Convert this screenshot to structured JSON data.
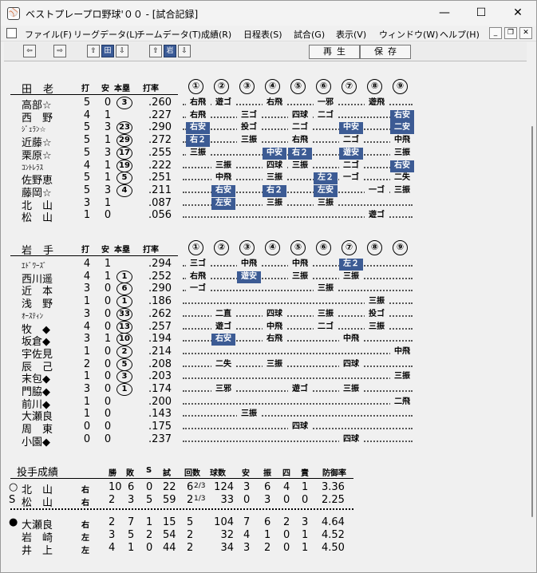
{
  "window": {
    "title": "ベストプレープロ野球'００ - [試合記録]",
    "minimize": "—",
    "maximize": "☐",
    "close": "✕"
  },
  "menu": [
    "ファイル(F)",
    "リーグデータ(L)",
    "チームデータ(T)",
    "成績(R)",
    "日程表(S)",
    "試合(G)",
    "表示(V)",
    "ウィンドウ(W)",
    "ヘルプ(H)"
  ],
  "toolbar": {
    "play_label": "再生",
    "save_label": "保存",
    "left_arrow": "⇦",
    "right_arrow": "⇨",
    "up_arrow_1": "⇧",
    "tag_1": "田",
    "down_arrow_1": "⇩",
    "up_arrow_2": "⇧",
    "tag_2": "岩",
    "down_arrow_2": "⇩"
  },
  "headers": {
    "ab": "打",
    "hits": "安",
    "hr": "本塁",
    "avg": "打率",
    "innings": [
      "①",
      "②",
      "③",
      "④",
      "⑤",
      "⑥",
      "⑦",
      "⑧",
      "⑨"
    ]
  },
  "teams": [
    {
      "name": "田老",
      "batters": [
        {
          "name": "高部☆",
          "ab": "5",
          "h": "0",
          "hr": "3",
          "avg": ".260",
          "res": [
            "右飛",
            "遊ゴ",
            "",
            "右飛",
            "",
            "一邪",
            "",
            "遊飛",
            ""
          ]
        },
        {
          "name": "西　野",
          "ab": "4",
          "h": "1",
          "hr": "",
          "avg": ".227",
          "res": [
            "右飛",
            "",
            "三ゴ",
            "",
            "四球",
            "二ゴ",
            "",
            "",
            "右安"
          ]
        },
        {
          "name": "ｼﾞｪﾗﾝ☆",
          "ab": "5",
          "h": "3",
          "hr": "23",
          "avg": ".290",
          "res": [
            "右安",
            "",
            "投ゴ",
            "",
            "二ゴ",
            "",
            "中安",
            "",
            "二安"
          ]
        },
        {
          "name": "近藤☆",
          "ab": "5",
          "h": "1",
          "hr": "29",
          "avg": ".272",
          "res": [
            "右２",
            "",
            "三振",
            "",
            "右飛",
            "",
            "二ゴ",
            "",
            "中飛"
          ]
        },
        {
          "name": "栗原☆",
          "ab": "5",
          "h": "3",
          "hr": "17",
          "avg": ".255",
          "res": [
            "三振",
            "",
            "",
            "中安",
            "右２",
            "",
            "遊安",
            "",
            "三振"
          ]
        },
        {
          "name": "ｺﾝﾄﾚﾗｽ",
          "ab": "4",
          "h": "1",
          "hr": "19",
          "avg": ".222",
          "res": [
            "",
            "三振",
            "",
            "四球",
            "三振",
            "",
            "二ゴ",
            "",
            "右安"
          ]
        },
        {
          "name": "佐野恵",
          "ab": "5",
          "h": "1",
          "hr": "5",
          "avg": ".251",
          "res": [
            "",
            "中飛",
            "",
            "三振",
            "",
            "左２",
            "一ゴ",
            "",
            "二失"
          ]
        },
        {
          "name": "藤岡☆",
          "ab": "5",
          "h": "3",
          "hr": "4",
          "avg": ".211",
          "res": [
            "",
            "右安",
            "",
            "右２",
            "",
            "左安",
            "",
            "一ゴ",
            "三振"
          ]
        },
        {
          "name": "北　山",
          "ab": "3",
          "h": "1",
          "hr": "",
          "avg": ".087",
          "res": [
            "",
            "左安",
            "",
            "三振",
            "",
            "三振",
            "",
            "",
            ""
          ]
        },
        {
          "name": "松　山",
          "ab": "1",
          "h": "0",
          "hr": "",
          "avg": ".056",
          "res": [
            "",
            "",
            "",
            "",
            "",
            "",
            "",
            "遊ゴ",
            ""
          ]
        }
      ]
    },
    {
      "name": "岩手",
      "batters": [
        {
          "name": "ｴﾄﾞﾜｰｽﾞ",
          "ab": "4",
          "h": "1",
          "hr": "",
          "avg": ".294",
          "res": [
            "三ゴ",
            "",
            "中飛",
            "",
            "中飛",
            "",
            "左２",
            "",
            ""
          ]
        },
        {
          "name": "西川遥",
          "ab": "4",
          "h": "1",
          "hr": "1",
          "avg": ".252",
          "res": [
            "右飛",
            "",
            "遊安",
            "",
            "三振",
            "",
            "三振",
            "",
            ""
          ]
        },
        {
          "name": "近　本",
          "ab": "3",
          "h": "0",
          "hr": "6",
          "avg": ".290",
          "res": [
            "一ゴ",
            "",
            "",
            "",
            "",
            "三振",
            "",
            "",
            ""
          ]
        },
        {
          "name": "浅　野",
          "ab": "1",
          "h": "0",
          "hr": "1",
          "avg": ".186",
          "res": [
            "",
            "",
            "",
            "",
            "",
            "",
            "",
            "三振",
            ""
          ]
        },
        {
          "name": "ｵｰｽﾃｨﾝ",
          "ab": "3",
          "h": "0",
          "hr": "33",
          "avg": ".262",
          "res": [
            "",
            "二直",
            "",
            "四球",
            "",
            "三振",
            "",
            "投ゴ",
            ""
          ]
        },
        {
          "name": "牧　◆",
          "ab": "4",
          "h": "0",
          "hr": "13",
          "avg": ".257",
          "res": [
            "",
            "遊ゴ",
            "",
            "中飛",
            "",
            "二ゴ",
            "",
            "三振",
            ""
          ]
        },
        {
          "name": "坂倉◆",
          "ab": "3",
          "h": "1",
          "hr": "10",
          "avg": ".194",
          "res": [
            "",
            "右安",
            "",
            "右飛",
            "",
            "",
            "中飛",
            "",
            ""
          ]
        },
        {
          "name": "宇佐見",
          "ab": "1",
          "h": "0",
          "hr": "2",
          "avg": ".214",
          "res": [
            "",
            "",
            "",
            "",
            "",
            "",
            "",
            "",
            "中飛"
          ]
        },
        {
          "name": "辰　己",
          "ab": "2",
          "h": "0",
          "hr": "5",
          "avg": ".208",
          "res": [
            "",
            "二失",
            "",
            "三振",
            "",
            "",
            "四球",
            "",
            ""
          ]
        },
        {
          "name": "末包◆",
          "ab": "1",
          "h": "0",
          "hr": "3",
          "avg": ".203",
          "res": [
            "",
            "",
            "",
            "",
            "",
            "",
            "",
            "",
            "三振"
          ]
        },
        {
          "name": "門脇◆",
          "ab": "3",
          "h": "0",
          "hr": "1",
          "avg": ".174",
          "res": [
            "",
            "三邪",
            "",
            "",
            "遊ゴ",
            "",
            "三振",
            "",
            ""
          ]
        },
        {
          "name": "前川◆",
          "ab": "1",
          "h": "0",
          "hr": "",
          "avg": ".200",
          "res": [
            "",
            "",
            "",
            "",
            "",
            "",
            "",
            "",
            "二飛"
          ]
        },
        {
          "name": "大瀬良",
          "ab": "1",
          "h": "0",
          "hr": "",
          "avg": ".143",
          "res": [
            "",
            "",
            "三振",
            "",
            "",
            "",
            "",
            "",
            ""
          ]
        },
        {
          "name": "周　東",
          "ab": "0",
          "h": "0",
          "hr": "",
          "avg": ".175",
          "res": [
            "",
            "",
            "",
            "",
            "四球",
            "",
            "",
            "",
            ""
          ]
        },
        {
          "name": "小園◆",
          "ab": "0",
          "h": "0",
          "hr": "",
          "avg": ".237",
          "res": [
            "",
            "",
            "",
            "",
            "",
            "",
            "四球",
            "",
            ""
          ]
        }
      ]
    }
  ],
  "pitching": {
    "title": "投手成績",
    "headers": [
      "勝",
      "敗",
      "S",
      "試",
      "回数",
      "球数",
      "安",
      "振",
      "四",
      "責",
      "防御率"
    ],
    "groups": [
      [
        {
          "mark": "○",
          "name": "北　山",
          "hand": "右",
          "w": "10",
          "l": "6",
          "s": "0",
          "g": "22",
          "ip": "6",
          "ipf": "2/3",
          "np": "124",
          "h": "3",
          "so": "6",
          "bb": "4",
          "er": "1",
          "era": "3.36"
        },
        {
          "mark": "S",
          "name": "松　山",
          "hand": "右",
          "w": "2",
          "l": "3",
          "s": "5",
          "g": "59",
          "ip": "2",
          "ipf": "1/3",
          "np": "33",
          "h": "0",
          "so": "3",
          "bb": "0",
          "er": "0",
          "era": "2.25"
        }
      ],
      [
        {
          "mark": "●",
          "name": "大瀬良",
          "hand": "右",
          "w": "2",
          "l": "7",
          "s": "1",
          "g": "15",
          "ip": "5",
          "ipf": "",
          "np": "104",
          "h": "7",
          "so": "6",
          "bb": "2",
          "er": "3",
          "era": "4.64"
        },
        {
          "mark": "",
          "name": "岩　崎",
          "hand": "左",
          "w": "3",
          "l": "5",
          "s": "2",
          "g": "54",
          "ip": "2",
          "ipf": "",
          "np": "32",
          "h": "4",
          "so": "1",
          "bb": "0",
          "er": "1",
          "era": "4.52"
        },
        {
          "mark": "",
          "name": "井　上",
          "hand": "左",
          "w": "4",
          "l": "1",
          "s": "0",
          "g": "44",
          "ip": "2",
          "ipf": "",
          "np": "34",
          "h": "3",
          "so": "2",
          "bb": "0",
          "er": "1",
          "era": "4.50"
        }
      ]
    ]
  },
  "colors": {
    "highlight": "#3c5b94",
    "background": "#f0f0f0"
  }
}
